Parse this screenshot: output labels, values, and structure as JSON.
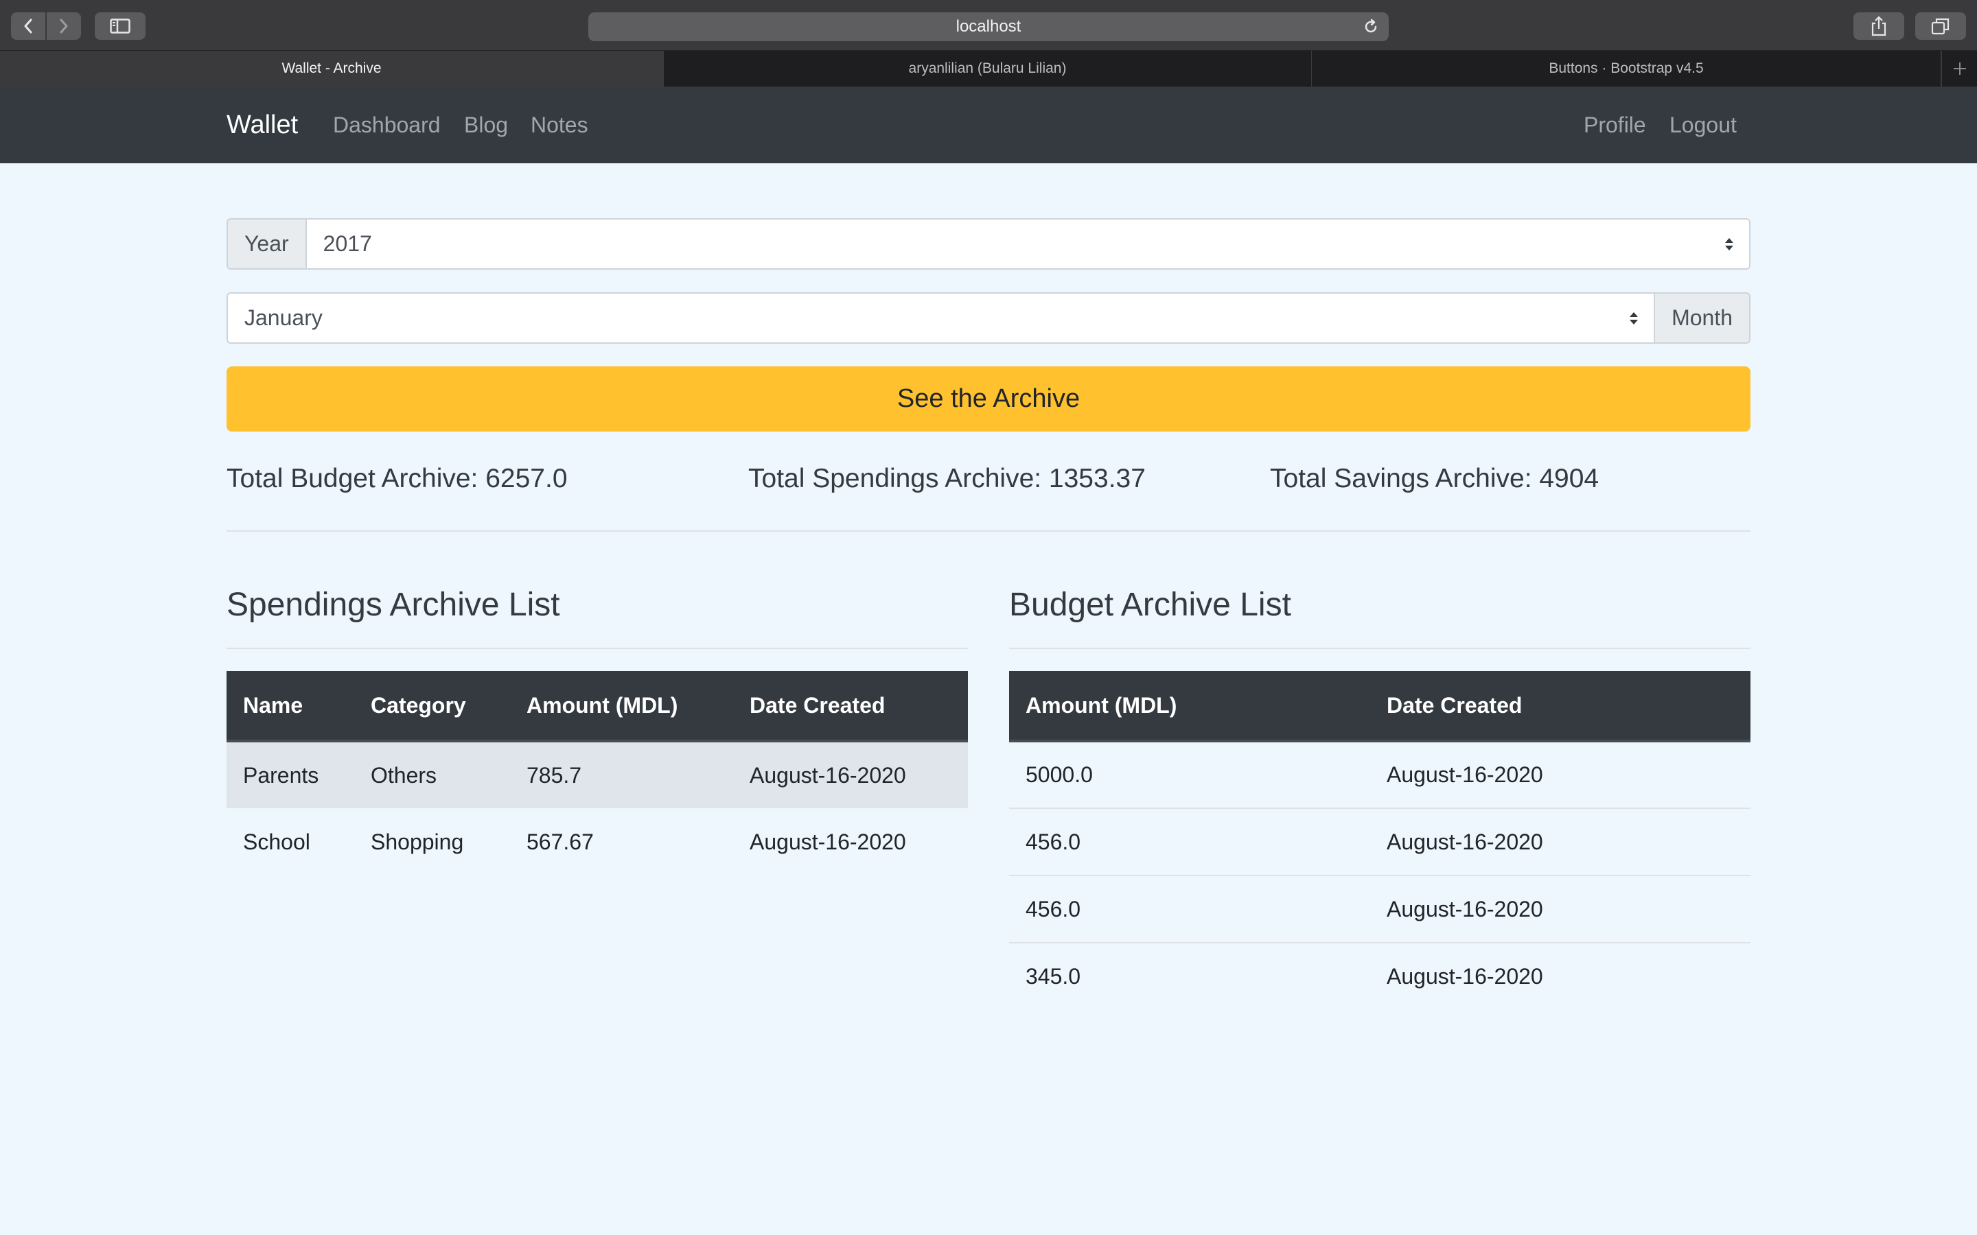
{
  "browser": {
    "url": "localhost",
    "tabs": [
      {
        "title": "Wallet - Archive",
        "active": true
      },
      {
        "title": "aryanlilian (Bularu Lilian)",
        "active": false
      },
      {
        "title": "Buttons · Bootstrap v4.5",
        "active": false
      }
    ]
  },
  "navbar": {
    "brand": "Wallet",
    "links": [
      "Dashboard",
      "Blog",
      "Notes"
    ],
    "right_links": [
      "Profile",
      "Logout"
    ]
  },
  "filters": {
    "year_label": "Year",
    "year_value": "2017",
    "month_value": "January",
    "month_label": "Month"
  },
  "archive_button": "See the Archive",
  "totals": {
    "budget": "Total Budget Archive: 6257.0",
    "spendings": "Total Spendings Archive: 1353.37",
    "savings": "Total Savings Archive: 4904"
  },
  "spendings": {
    "title": "Spendings Archive List",
    "columns": [
      "Name",
      "Category",
      "Amount (MDL)",
      "Date Created"
    ],
    "rows": [
      [
        "Parents",
        "Others",
        "785.7",
        "August-16-2020"
      ],
      [
        "School",
        "Shopping",
        "567.67",
        "August-16-2020"
      ]
    ]
  },
  "budget": {
    "title": "Budget Archive List",
    "columns": [
      "Amount (MDL)",
      "Date Created"
    ],
    "rows": [
      [
        "5000.0",
        "August-16-2020"
      ],
      [
        "456.0",
        "August-16-2020"
      ],
      [
        "456.0",
        "August-16-2020"
      ],
      [
        "345.0",
        "August-16-2020"
      ]
    ]
  },
  "colors": {
    "navbar": "#343a40",
    "page_background": "#eef6fe",
    "button_warning": "#ffc12d"
  }
}
